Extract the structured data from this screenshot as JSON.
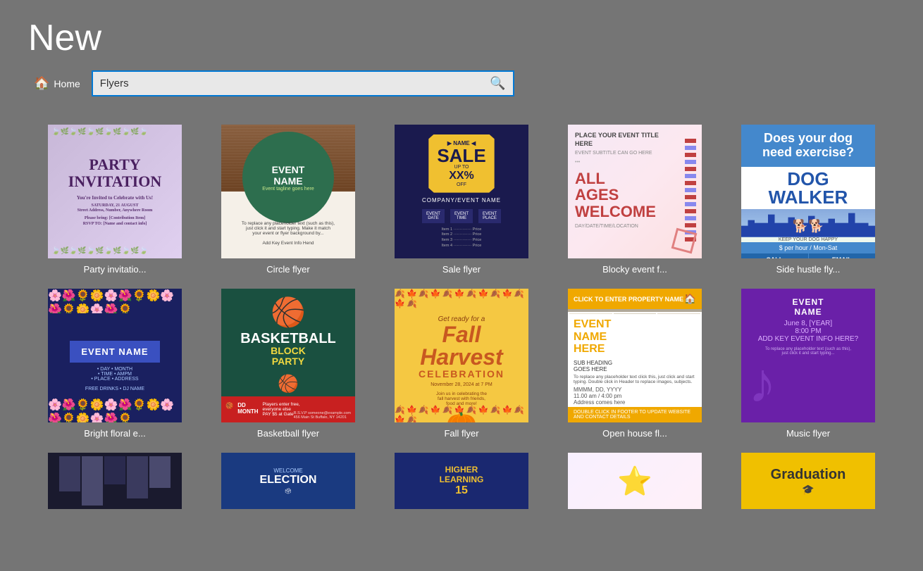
{
  "page": {
    "title": "New"
  },
  "search": {
    "home_label": "Home",
    "placeholder": "Flyers",
    "search_value": "Flyers"
  },
  "templates": {
    "row1": [
      {
        "id": "party-invitation",
        "label": "Party invitatio...",
        "design": "party"
      },
      {
        "id": "circle-flyer",
        "label": "Circle flyer",
        "design": "circle"
      },
      {
        "id": "sale-flyer",
        "label": "Sale flyer",
        "design": "sale"
      },
      {
        "id": "blocky-event-flyer",
        "label": "Blocky event f...",
        "design": "blocky"
      },
      {
        "id": "side-hustle-flyer",
        "label": "Side hustle fly...",
        "design": "dog"
      }
    ],
    "row2": [
      {
        "id": "bright-floral-event",
        "label": "Bright floral e...",
        "design": "floral"
      },
      {
        "id": "basketball-flyer",
        "label": "Basketball flyer",
        "design": "basketball"
      },
      {
        "id": "fall-flyer",
        "label": "Fall flyer",
        "design": "fall"
      },
      {
        "id": "open-house-flyer",
        "label": "Open house fl...",
        "design": "openhouse",
        "has_dot": true
      },
      {
        "id": "music-flyer",
        "label": "Music flyer",
        "design": "music"
      }
    ],
    "row3": [
      {
        "id": "dark-flyer",
        "label": "",
        "design": "dark"
      },
      {
        "id": "election-flyer",
        "label": "",
        "design": "election"
      },
      {
        "id": "education-flyer",
        "label": "",
        "design": "education"
      },
      {
        "id": "star-flyer",
        "label": "",
        "design": "star"
      },
      {
        "id": "graduation-flyer",
        "label": "",
        "design": "graduation"
      }
    ]
  }
}
